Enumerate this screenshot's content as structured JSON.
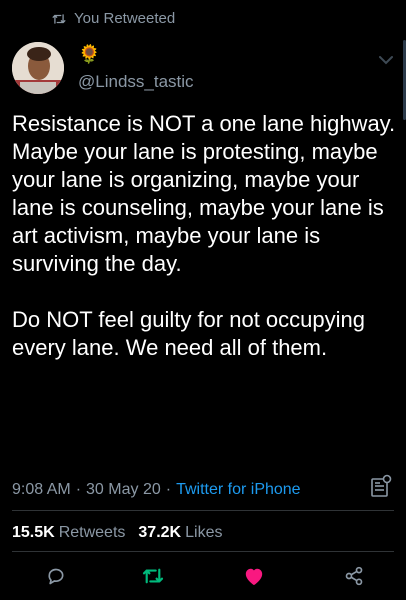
{
  "retweet_context": {
    "label": "You Retweeted",
    "icon": "retweet-icon"
  },
  "author": {
    "display_name": "🌻",
    "handle": "@Lindss_tastic"
  },
  "tweet": {
    "text": "Resistance is NOT a one lane highway. Maybe your lane is protesting, maybe your lane is organizing, maybe your lane is counseling, maybe your lane is art activism, maybe your lane is surviving the day.\n\nDo NOT feel guilty for not occupying every lane. We need all of them."
  },
  "meta": {
    "time": "9:08 AM",
    "separator_1": "·",
    "date": "30 May 20",
    "separator_2": "·",
    "source": "Twitter for iPhone"
  },
  "stats": {
    "retweets_count": "15.5K",
    "retweets_label": "Retweets",
    "likes_count": "37.2K",
    "likes_label": "Likes"
  },
  "colors": {
    "background": "#000000",
    "text": "#ffffff",
    "muted": "#8b98a5",
    "link": "#1d9bf0",
    "retweet_active": "#00ba7c",
    "like_active": "#f91880"
  }
}
